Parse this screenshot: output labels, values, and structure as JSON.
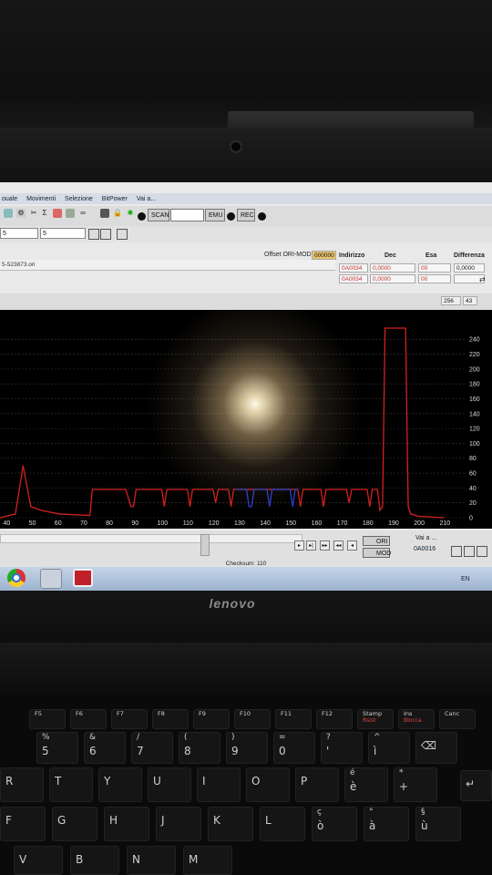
{
  "menu": [
    "ouale",
    "Movimenti",
    "Selezione",
    "BitPower",
    "Vai a..."
  ],
  "toolbar": {
    "scan_label": "SCAN",
    "emu_label": "EMU",
    "rec_label": "REC",
    "spin1_value": "5",
    "spin2_value": "5"
  },
  "header": {
    "offset_label": "Offset ORI-MOD",
    "offset_value": "000000",
    "col_indirizzo": "Indirizzo",
    "col_dec": "Dec",
    "col_esa": "Esa",
    "col_diff": "Differenza",
    "file_name": "5-523873.ori",
    "rows": [
      {
        "addr": "0A0034",
        "dec": "0,0000",
        "esa": "00",
        "diff": "0,0000"
      },
      {
        "addr": "0A0034",
        "dec": "0,0000",
        "esa": "00",
        "diff": ""
      }
    ],
    "info_a": "256",
    "info_b": "43"
  },
  "chart_data": {
    "type": "line",
    "x_ticks": [
      40,
      50,
      60,
      70,
      80,
      90,
      100,
      110,
      120,
      130,
      140,
      150,
      160,
      170,
      180,
      190,
      200,
      210
    ],
    "y_ticks": [
      0,
      20,
      40,
      60,
      80,
      100,
      120,
      140,
      160,
      180,
      200,
      220,
      240
    ],
    "xlim": [
      37,
      218
    ],
    "ylim": [
      0,
      255
    ],
    "series": [
      {
        "color": "#d42020",
        "points": [
          [
            37,
            0
          ],
          [
            43,
            5
          ],
          [
            46,
            70
          ],
          [
            49,
            15
          ],
          [
            53,
            10
          ],
          [
            60,
            5
          ],
          [
            72,
            3
          ],
          [
            73,
            38
          ],
          [
            80,
            38
          ],
          [
            81,
            38
          ],
          [
            86,
            38
          ],
          [
            88,
            15
          ],
          [
            89,
            15
          ],
          [
            90,
            38
          ],
          [
            100,
            38
          ],
          [
            101,
            15
          ],
          [
            102,
            38
          ],
          [
            110,
            38
          ],
          [
            111,
            15
          ],
          [
            112,
            38
          ],
          [
            120,
            38
          ],
          [
            121,
            20
          ],
          [
            122,
            38
          ],
          [
            126,
            38
          ],
          [
            127,
            15
          ],
          [
            128,
            38
          ],
          [
            129,
            38
          ],
          [
            153,
            38
          ],
          [
            154,
            15
          ],
          [
            155,
            38
          ],
          [
            162,
            38
          ],
          [
            163,
            15
          ],
          [
            164,
            38
          ],
          [
            172,
            38
          ],
          [
            173,
            20
          ],
          [
            174,
            38
          ],
          [
            180,
            38
          ],
          [
            181,
            15
          ],
          [
            182,
            38
          ],
          [
            184,
            38
          ],
          [
            185,
            10
          ],
          [
            186,
            15
          ],
          [
            187,
            255
          ],
          [
            195,
            255
          ],
          [
            196,
            15
          ],
          [
            197,
            5
          ],
          [
            200,
            2
          ],
          [
            210,
            0
          ]
        ]
      },
      {
        "color": "#2a3dd0",
        "points": [
          [
            129,
            38
          ],
          [
            133,
            38
          ],
          [
            134,
            15
          ],
          [
            135,
            15
          ],
          [
            136,
            38
          ],
          [
            141,
            38
          ],
          [
            142,
            15
          ],
          [
            143,
            38
          ],
          [
            150,
            38
          ],
          [
            151,
            15
          ],
          [
            152,
            38
          ],
          [
            153,
            38
          ]
        ]
      }
    ],
    "grid": true
  },
  "lower": {
    "ori_label": "ORI",
    "mod_label": "MOD",
    "vai_label": "Vai a ...",
    "addr_value": "0A0016",
    "checksum": "Checksum: 110"
  },
  "taskbar": {
    "lang": "EN"
  },
  "laptop": {
    "brand": "lenovo"
  },
  "keys": {
    "row0": [
      [
        "F5",
        ""
      ],
      [
        "F6",
        ""
      ],
      [
        "F7",
        ""
      ],
      [
        "F8",
        ""
      ],
      [
        "F9",
        ""
      ],
      [
        "F10",
        ""
      ],
      [
        "F11",
        ""
      ],
      [
        "F12",
        ""
      ],
      [
        "Stamp",
        "Rsist"
      ],
      [
        "Ins",
        "Blocca"
      ],
      [
        "Canc",
        ""
      ]
    ],
    "row1": [
      "%\n5",
      "&\n6",
      "/\n7",
      "(\n8",
      ")\n9",
      "=\n0",
      "?\n'",
      "^\nì",
      "⌫"
    ],
    "row2": [
      "R",
      "T",
      "Y",
      "U",
      "I",
      "O",
      "P",
      "é\nè",
      "*\n+"
    ],
    "row3": [
      "F",
      "G",
      "H",
      "J",
      "K",
      "L",
      "ç\nò",
      "°\nà",
      "§\nù"
    ],
    "row4": [
      "V",
      "B",
      "N",
      "M"
    ]
  }
}
